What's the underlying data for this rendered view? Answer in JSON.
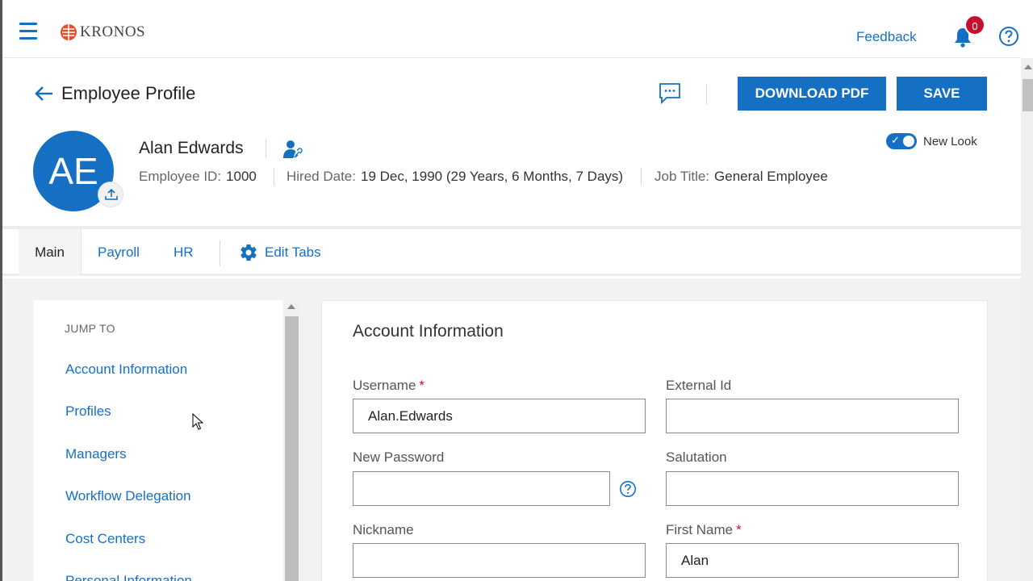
{
  "app": {
    "logo_text": "KRONOS",
    "feedback_label": "Feedback",
    "notification_count": "0"
  },
  "header": {
    "title": "Employee Profile",
    "download_pdf_label": "DOWNLOAD PDF",
    "save_label": "SAVE",
    "new_look_label": "New Look",
    "new_look_enabled": true
  },
  "employee": {
    "initials": "AE",
    "name": "Alan Edwards",
    "employee_id_label": "Employee ID:",
    "employee_id": "1000",
    "hired_date_label": "Hired Date:",
    "hired_date": "19 Dec, 1990 (29 Years, 6 Months, 7 Days)",
    "job_title_label": "Job Title:",
    "job_title": "General Employee"
  },
  "tabs": {
    "items": [
      {
        "label": "Main",
        "active": true
      },
      {
        "label": "Payroll",
        "active": false
      },
      {
        "label": "HR",
        "active": false
      }
    ],
    "edit_label": "Edit Tabs"
  },
  "jump_to": {
    "title": "JUMP TO",
    "items": [
      "Account Information",
      "Profiles",
      "Managers",
      "Workflow Delegation",
      "Cost Centers",
      "Personal Information"
    ]
  },
  "account": {
    "title": "Account Information",
    "fields": {
      "username": {
        "label": "Username",
        "required": "*",
        "value": "Alan.Edwards"
      },
      "external_id": {
        "label": "External Id",
        "value": ""
      },
      "new_password": {
        "label": "New Password",
        "value": ""
      },
      "salutation": {
        "label": "Salutation",
        "value": ""
      },
      "nickname": {
        "label": "Nickname",
        "value": ""
      },
      "first_name": {
        "label": "First Name",
        "required": "*",
        "value": "Alan"
      }
    }
  },
  "colors": {
    "accent": "#1570c4",
    "required": "#c8102e",
    "badge": "#c8102e"
  },
  "icons": {
    "menu": "hamburger-icon",
    "bell": "bell-icon",
    "help": "help-icon",
    "back": "arrow-left-icon",
    "comment": "comment-icon",
    "gear": "gear-icon",
    "upload": "upload-icon",
    "person_link": "person-link-icon"
  }
}
